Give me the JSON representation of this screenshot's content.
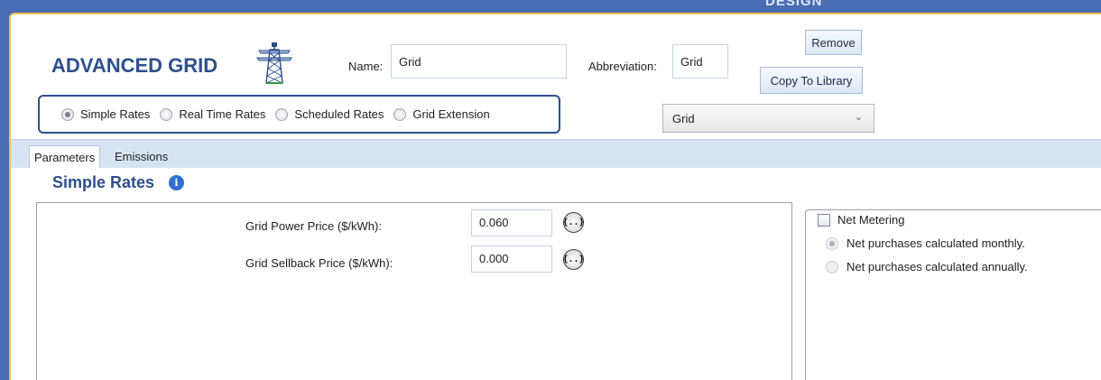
{
  "window": {
    "section_label": "DESIGN"
  },
  "header": {
    "title": "ADVANCED GRID",
    "name_label": "Name:",
    "name_value": "Grid",
    "abbreviation_label": "Abbreviation:",
    "abbreviation_value": "Grid",
    "remove_label": "Remove",
    "copy_label": "Copy To Library",
    "library_select_value": "Grid"
  },
  "rate_type": {
    "options": [
      {
        "label": "Simple Rates",
        "checked": true
      },
      {
        "label": "Real Time Rates",
        "checked": false
      },
      {
        "label": "Scheduled Rates",
        "checked": false
      },
      {
        "label": "Grid Extension",
        "checked": false
      }
    ]
  },
  "tabs": [
    {
      "label": "Parameters",
      "active": true
    },
    {
      "label": "Emissions",
      "active": false
    }
  ],
  "section": {
    "title": "Simple Rates",
    "info_glyph": "i"
  },
  "fields": [
    {
      "label": "Grid Power Price ($/kWh):",
      "value": "0.060",
      "button": "{..}"
    },
    {
      "label": "Grid Sellback Price ($/kWh):",
      "value": "0.000",
      "button": "{..}"
    }
  ],
  "net_metering": {
    "label": "Net Metering",
    "checked": false,
    "options": [
      {
        "label": "Net purchases calculated monthly.",
        "checked": true
      },
      {
        "label": "Net purchases calculated annually.",
        "checked": false
      }
    ]
  },
  "colors": {
    "accent": "#2e4f8c",
    "frame": "#4a6cb3",
    "border_gold": "#f0c24a"
  },
  "icons": {
    "tower": "transmission-tower-icon",
    "info": "info-icon",
    "chevron": "chevron-down-icon"
  }
}
